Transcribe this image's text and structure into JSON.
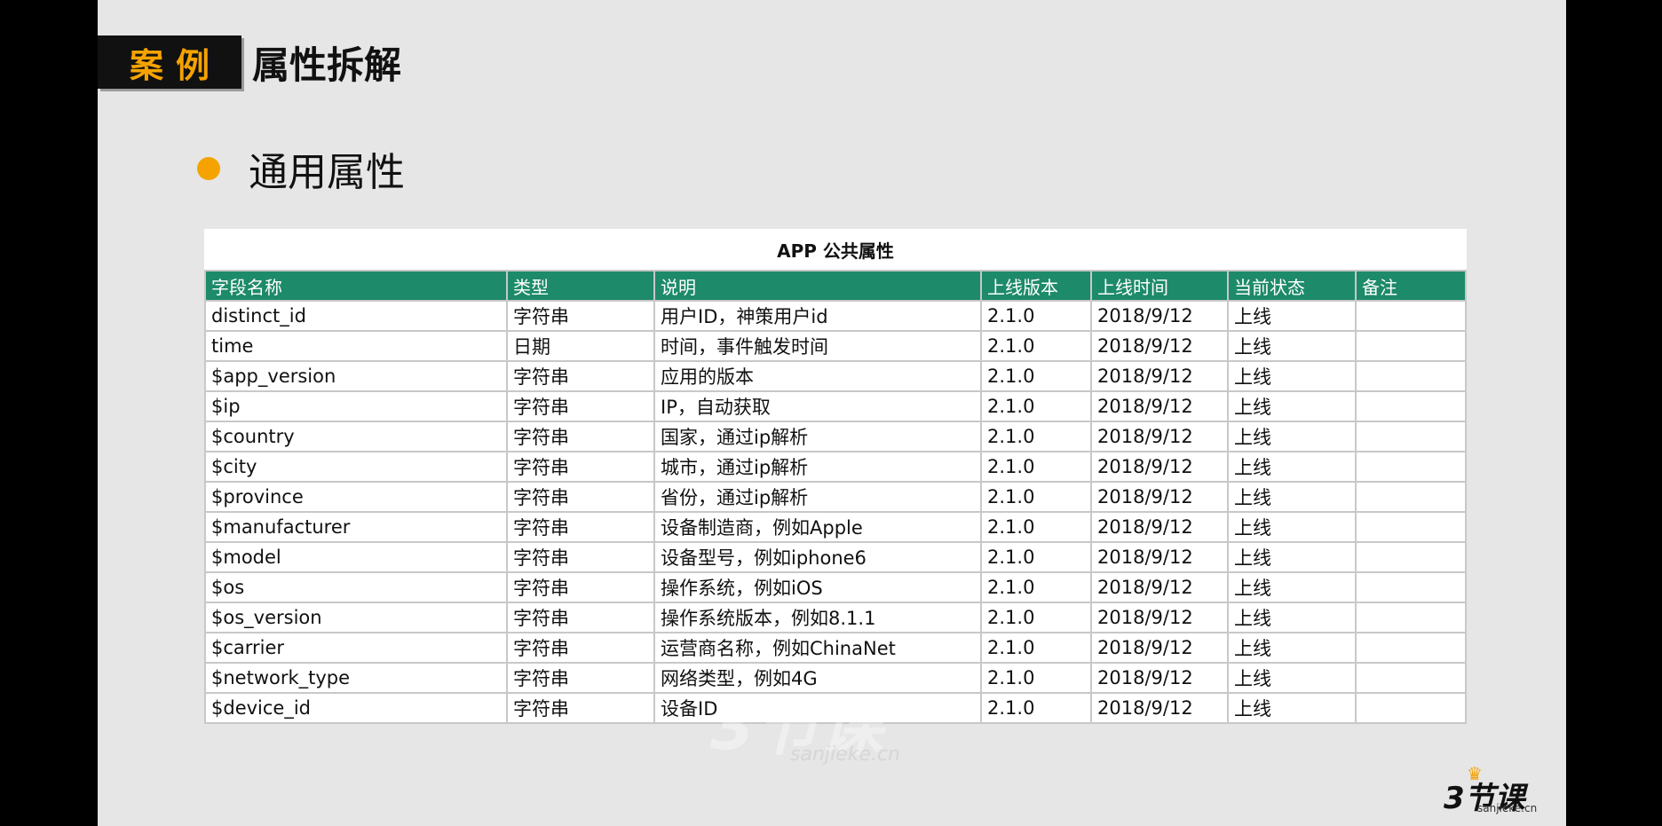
{
  "header": {
    "badge": "案例",
    "title": "属性拆解"
  },
  "section": {
    "subtitle": "通用属性"
  },
  "table": {
    "caption": "APP 公共属性",
    "columns": [
      "字段名称",
      "类型",
      "说明",
      "上线版本",
      "上线时间",
      "当前状态",
      "备注"
    ],
    "rows": [
      [
        "distinct_id",
        "字符串",
        "用户ID，神策用户id",
        "2.1.0",
        "2018/9/12",
        "上线",
        ""
      ],
      [
        "time",
        "日期",
        "时间，事件触发时间",
        "2.1.0",
        "2018/9/12",
        "上线",
        ""
      ],
      [
        "$app_version",
        "字符串",
        "应用的版本",
        "2.1.0",
        "2018/9/12",
        "上线",
        ""
      ],
      [
        "$ip",
        "字符串",
        "IP，自动获取",
        "2.1.0",
        "2018/9/12",
        "上线",
        ""
      ],
      [
        "$country",
        "字符串",
        "国家，通过ip解析",
        "2.1.0",
        "2018/9/12",
        "上线",
        ""
      ],
      [
        "$city",
        "字符串",
        "城市，通过ip解析",
        "2.1.0",
        "2018/9/12",
        "上线",
        ""
      ],
      [
        "$province",
        "字符串",
        "省份，通过ip解析",
        "2.1.0",
        "2018/9/12",
        "上线",
        ""
      ],
      [
        "$manufacturer",
        "字符串",
        "设备制造商，例如Apple",
        "2.1.0",
        "2018/9/12",
        "上线",
        ""
      ],
      [
        "$model",
        "字符串",
        "设备型号，例如iphone6",
        "2.1.0",
        "2018/9/12",
        "上线",
        ""
      ],
      [
        "$os",
        "字符串",
        "操作系统，例如iOS",
        "2.1.0",
        "2018/9/12",
        "上线",
        ""
      ],
      [
        "$os_version",
        "字符串",
        "操作系统版本，例如8.1.1",
        "2.1.0",
        "2018/9/12",
        "上线",
        ""
      ],
      [
        "$carrier",
        "字符串",
        "运营商名称，例如ChinaNet",
        "2.1.0",
        "2018/9/12",
        "上线",
        ""
      ],
      [
        "$network_type",
        "字符串",
        "网络类型，例如4G",
        "2.1.0",
        "2018/9/12",
        "上线",
        ""
      ],
      [
        "$device_id",
        "字符串",
        "设备ID",
        "2.1.0",
        "2018/9/12",
        "上线",
        ""
      ]
    ]
  },
  "watermark": {
    "mark": "3节课",
    "site": "sanjieke.cn"
  },
  "logo": {
    "brand": "3节课",
    "site": "sanjieke.cn",
    "icon": "crown-icon"
  },
  "colors": {
    "accent": "#f5a300",
    "table_header": "#1d8a69",
    "slide_bg": "#e6e6e6"
  }
}
